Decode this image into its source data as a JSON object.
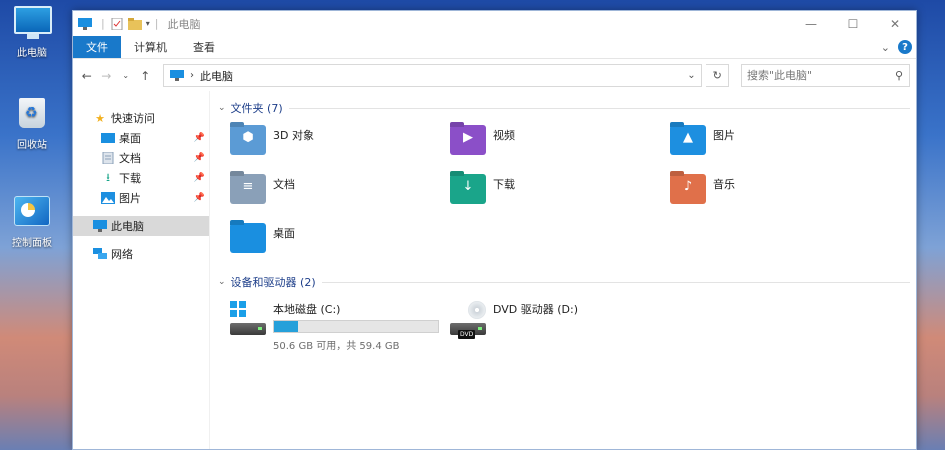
{
  "desktop": {
    "icons": [
      {
        "label": "此电脑",
        "icon": "monitor-icon"
      },
      {
        "label": "回收站",
        "icon": "recycle-bin-icon"
      },
      {
        "label": "控制面板",
        "icon": "control-panel-icon"
      }
    ]
  },
  "window": {
    "title": "此电脑",
    "controls": {
      "minimize": "—",
      "maximize": "☐",
      "close": "✕"
    }
  },
  "ribbon": {
    "tabs": [
      "文件",
      "计算机",
      "查看"
    ],
    "help": "?"
  },
  "navigation": {
    "address_path": "此电脑",
    "search_placeholder": "搜索\"此电脑\""
  },
  "sidebar": {
    "quick_access": "快速访问",
    "items": [
      {
        "label": "桌面",
        "icon": "desktop-icon",
        "pinned": true
      },
      {
        "label": "文档",
        "icon": "document-icon",
        "pinned": true
      },
      {
        "label": "下载",
        "icon": "download-icon",
        "pinned": true
      },
      {
        "label": "图片",
        "icon": "picture-icon",
        "pinned": true
      }
    ],
    "this_pc": "此电脑",
    "network": "网络"
  },
  "content": {
    "folders_header": "文件夹 (7)",
    "folders": [
      {
        "label": "3D 对象",
        "icon": "3d-objects-icon",
        "color": "#5b9bd5",
        "glyph": "⬢"
      },
      {
        "label": "视频",
        "icon": "video-icon",
        "color": "#8b4fc8",
        "glyph": "▶"
      },
      {
        "label": "图片",
        "icon": "picture-folder-icon",
        "color": "#1d8fe0",
        "glyph": "▲"
      },
      {
        "label": "文档",
        "icon": "documents-folder-icon",
        "color": "#8aa0b8",
        "glyph": "≡"
      },
      {
        "label": "下载",
        "icon": "downloads-folder-icon",
        "color": "#1aa58a",
        "glyph": "↓"
      },
      {
        "label": "音乐",
        "icon": "music-folder-icon",
        "color": "#e0704a",
        "glyph": "♪"
      },
      {
        "label": "桌面",
        "icon": "desktop-folder-icon",
        "color": "#1a8fe0",
        "glyph": ""
      }
    ],
    "drives_header": "设备和驱动器 (2)",
    "drives": [
      {
        "label": "本地磁盘 (C:)",
        "icon": "local-disk-icon",
        "free_text": "50.6 GB 可用，共 59.4 GB",
        "used_fraction": 0.148
      },
      {
        "label": "DVD 驱动器 (D:)",
        "icon": "dvd-drive-icon",
        "badge": "DVD"
      }
    ]
  }
}
